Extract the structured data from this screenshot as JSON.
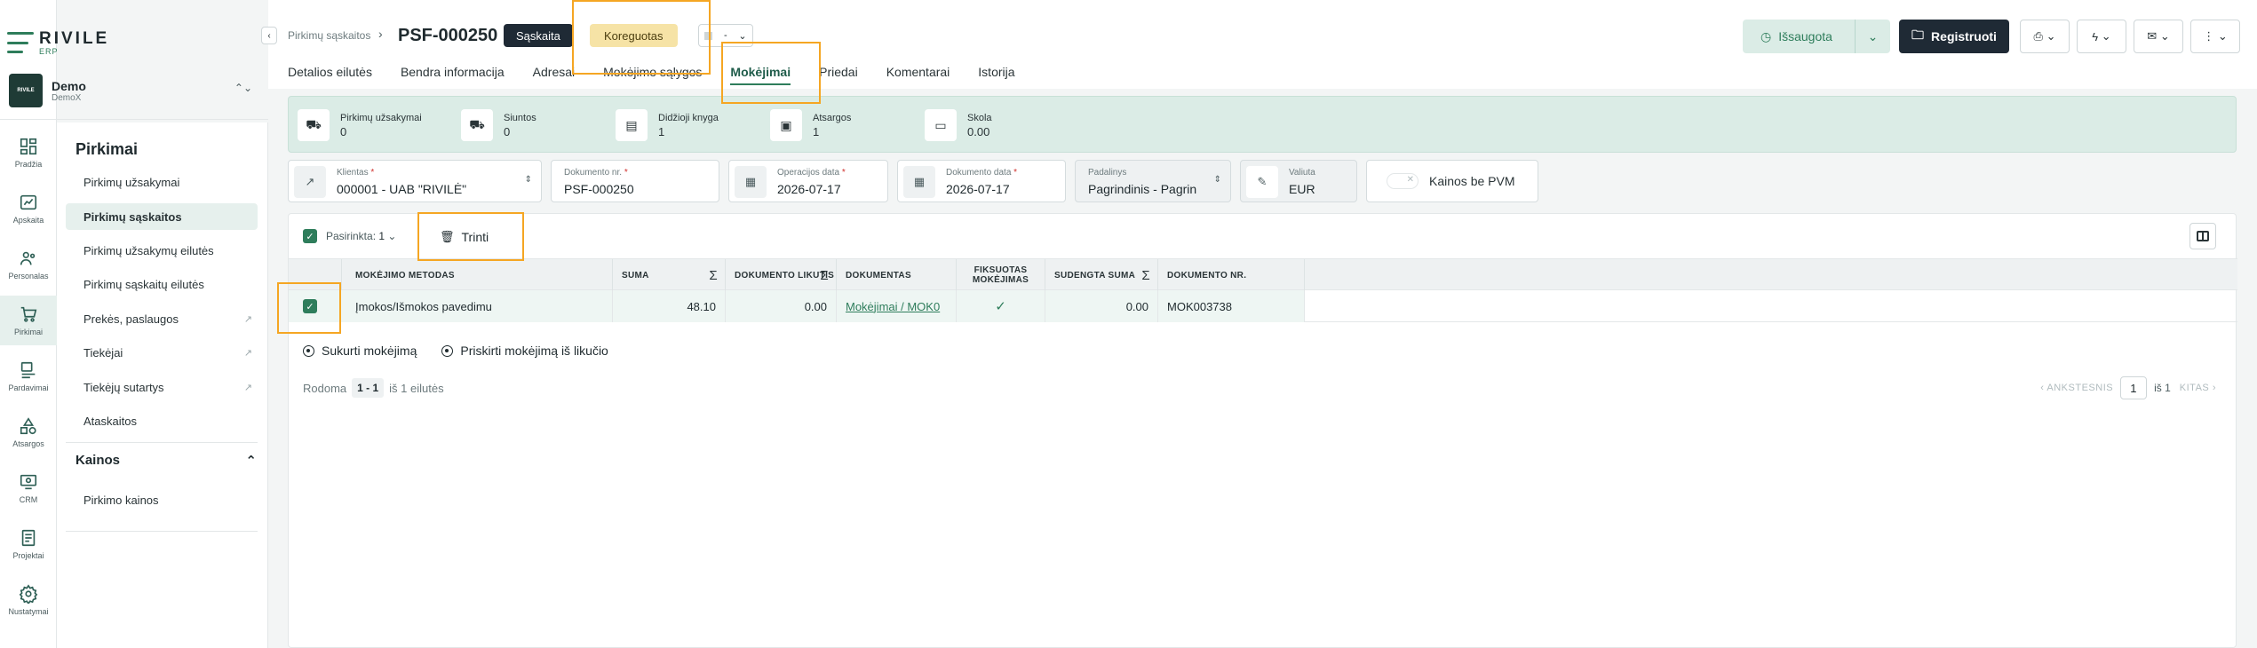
{
  "brand": {
    "name": "RIVILE",
    "sub": "ERP"
  },
  "company": {
    "name": "Demo",
    "sub": "DemoX",
    "badge": "RIVILE"
  },
  "rail": [
    {
      "label": "Pradžia",
      "icon": "dashboard-icon"
    },
    {
      "label": "Apskaita",
      "icon": "chart-icon"
    },
    {
      "label": "Personalas",
      "icon": "people-icon"
    },
    {
      "label": "Pirkimai",
      "icon": "cart-icon"
    },
    {
      "label": "Pardavimai",
      "icon": "sales-icon"
    },
    {
      "label": "Atsargos",
      "icon": "shapes-icon"
    },
    {
      "label": "CRM",
      "icon": "crm-icon"
    },
    {
      "label": "Projektai",
      "icon": "project-icon"
    },
    {
      "label": "Nustatymai",
      "icon": "gear-icon"
    }
  ],
  "subnav": {
    "title": "Pirkimai",
    "items": [
      {
        "label": "Pirkimų užsakymai"
      },
      {
        "label": "Pirkimų sąskaitos"
      },
      {
        "label": "Pirkimų užsakymų eilutės"
      },
      {
        "label": "Pirkimų sąskaitų eilutės"
      },
      {
        "label": "Prekės, paslaugos"
      },
      {
        "label": "Tiekėjai"
      },
      {
        "label": "Tiekėjų sutartys"
      },
      {
        "label": "Ataskaitos"
      }
    ],
    "group": "Kainos",
    "group_items": [
      {
        "label": "Pirkimo kainos"
      }
    ]
  },
  "header": {
    "breadcrumb": "Pirkimų sąskaitos",
    "doc_number": "PSF-000250",
    "type_pill": "Sąskaita",
    "status_pill": "Koreguotas",
    "select_value": "-",
    "saved_label": "Išsaugota",
    "register_label": "Registruoti"
  },
  "tabs": [
    {
      "label": "Detalios eilutės"
    },
    {
      "label": "Bendra informacija"
    },
    {
      "label": "Adresai"
    },
    {
      "label": "Mokėjimo sąlygos"
    },
    {
      "label": "Mokėjimai"
    },
    {
      "label": "Priedai"
    },
    {
      "label": "Komentarai"
    },
    {
      "label": "Istorija"
    }
  ],
  "stats": [
    {
      "label": "Pirkimų užsakymai",
      "value": "0"
    },
    {
      "label": "Siuntos",
      "value": "0"
    },
    {
      "label": "Didžioji knyga",
      "value": "1"
    },
    {
      "label": "Atsargos",
      "value": "1"
    },
    {
      "label": "Skola",
      "value": "0.00"
    }
  ],
  "fields": {
    "client": {
      "label": "Klientas",
      "value": "000001 - UAB \"RIVILĖ\""
    },
    "doc_no": {
      "label": "Dokumento nr.",
      "value": "PSF-000250"
    },
    "op_date": {
      "label": "Operacijos data",
      "value": "2026-07-17"
    },
    "doc_date": {
      "label": "Dokumento data",
      "value": "2026-07-17"
    },
    "division": {
      "label": "Padalinys",
      "value": "Pagrindinis - Pagrin"
    },
    "currency": {
      "label": "Valiuta",
      "value": "EUR"
    },
    "vat_toggle": "Kainos be PVM"
  },
  "table": {
    "selected_label": "Pasirinkta:",
    "selected_count": "1",
    "delete_label": "Trinti",
    "columns": [
      {
        "label": "Mokėjimo metodas"
      },
      {
        "label": "Suma"
      },
      {
        "label": "Dokumento likutis"
      },
      {
        "label": "Dokumentas"
      },
      {
        "label": "Fiksuotas mokėjimas"
      },
      {
        "label": "Sudengta suma"
      },
      {
        "label": "Dokumento nr."
      }
    ],
    "sigma": "Σ",
    "rows": [
      {
        "method": "Įmokos/Išmokos pavedimu",
        "amount": "48.10",
        "balance": "0.00",
        "document": "Mokėjimai / MOK0",
        "fixed": "✓",
        "settled": "0.00",
        "doc_no": "MOK003738"
      }
    ],
    "action_create": "Sukurti mokėjimą",
    "action_assign": "Priskirti mokėjimą iš likučio",
    "showing_label": "Rodoma",
    "showing_range": "1 - 1",
    "showing_of": "iš 1 eilutės",
    "prev_label": "ANKSTESNIS",
    "page": "1",
    "page_of": "iš 1",
    "next_label": "KITAS"
  }
}
